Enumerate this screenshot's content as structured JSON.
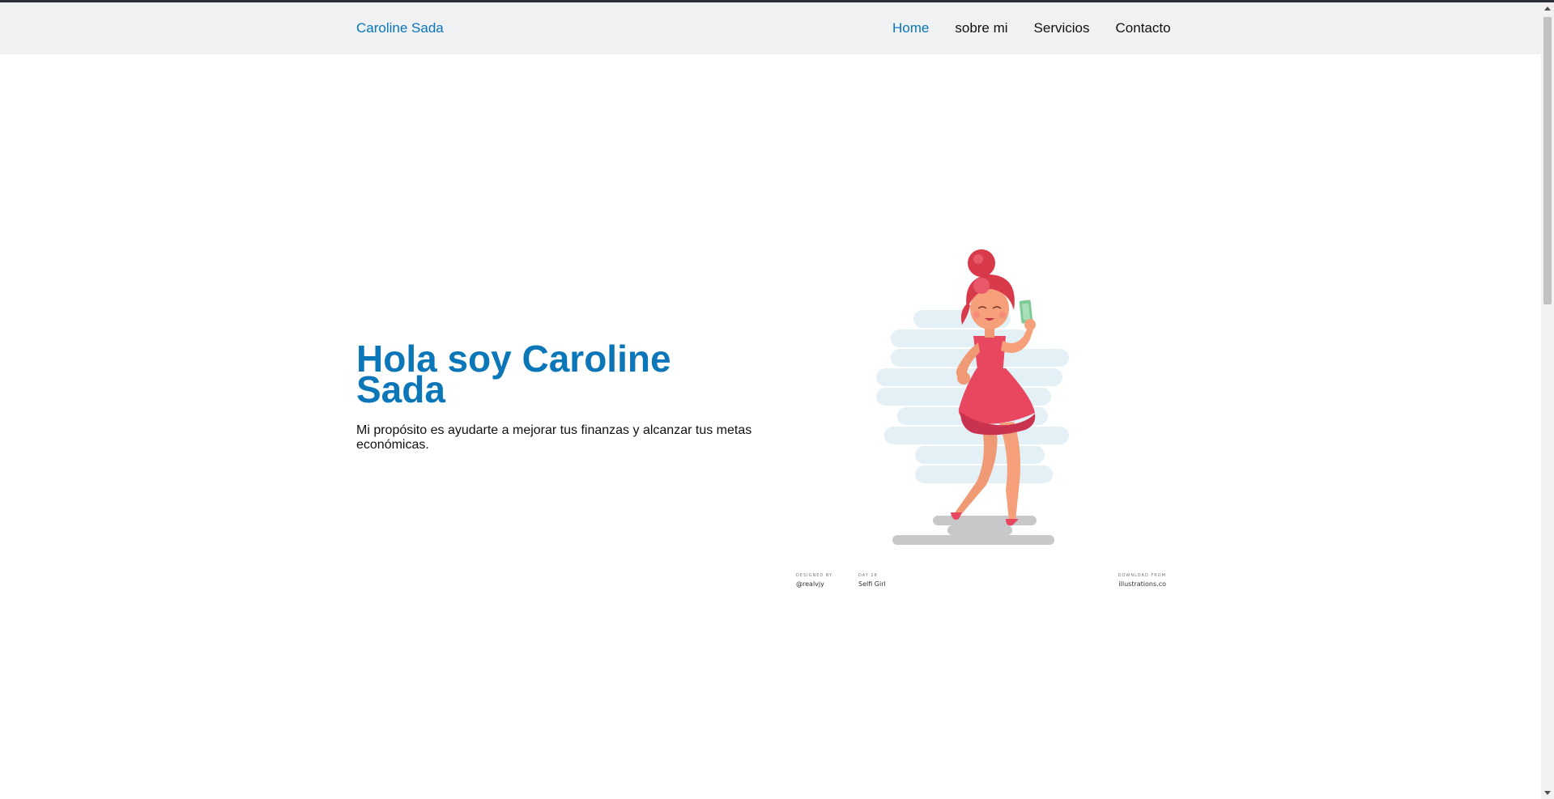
{
  "navbar": {
    "brand": "Caroline Sada",
    "links": [
      "Home",
      "sobre mi",
      "Servicios",
      "Contacto"
    ],
    "active": "Home"
  },
  "hero": {
    "title": "Hola soy Caroline Sada",
    "text": "Mi propósito es ayudarte a mejorar tus finanzas y alcanzar tus metas económicas."
  },
  "illustration": {
    "icon": "selfie-girl-illustration",
    "credits": {
      "designed_label": "DESIGNED BY",
      "designer": "@realvjy",
      "day_label": "DAY 28",
      "title": "Selfi Girl",
      "download_label": "DOWNLOAD FROM",
      "site": "illustrations.co"
    }
  },
  "colors": {
    "accent": "#0b76b8",
    "navbar_bg": "#eff1f3",
    "dress": "#e8475f",
    "hair": "#d83a4a",
    "skin": "#f5a07a",
    "cloud": "#e3f1f7",
    "shadow": "#c8c7c9",
    "phone": "#7ecb98"
  }
}
